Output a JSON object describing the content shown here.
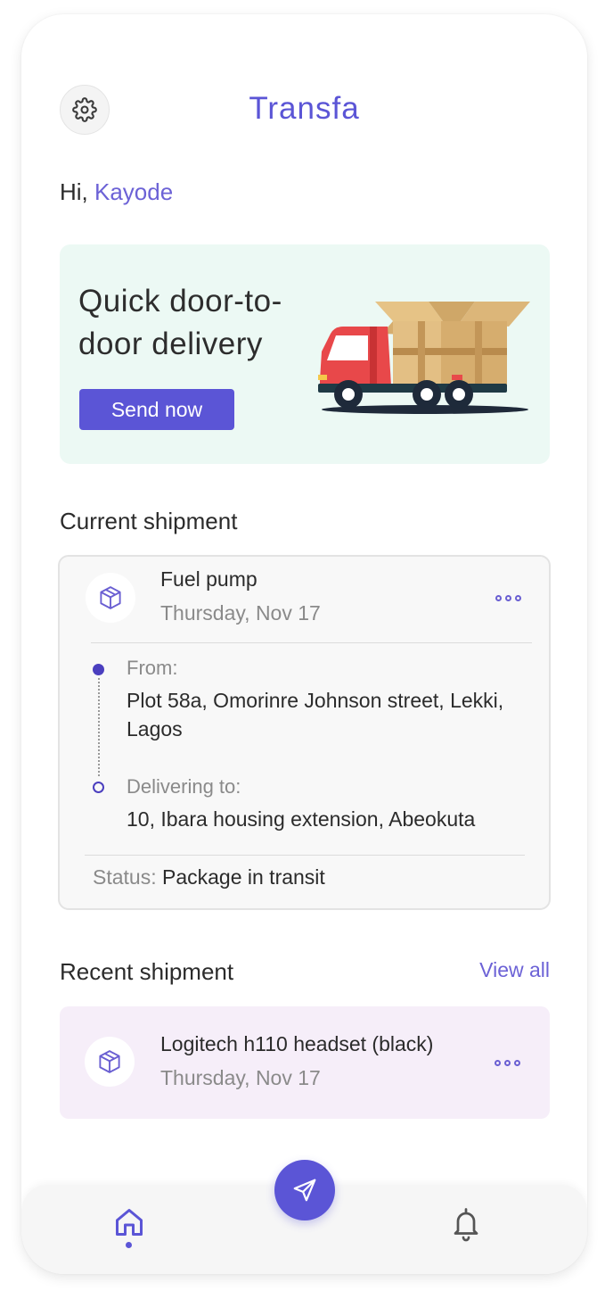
{
  "header": {
    "app_title": "Transfa"
  },
  "greeting": {
    "prefix": "Hi, ",
    "name": "Kayode"
  },
  "promo": {
    "title": "Quick door-to-door delivery",
    "button_label": "Send now"
  },
  "current_shipment": {
    "section_title": "Current shipment",
    "item_name": "Fuel pump",
    "date": "Thursday, Nov 17",
    "from_label": "From:",
    "from_address": "Plot 58a, Omorinre Johnson street, Lekki, Lagos",
    "to_label": "Delivering to:",
    "to_address": "10, Ibara housing extension, Abeokuta",
    "status_label": "Status: ",
    "status_value": "Package in transit"
  },
  "recent_shipment": {
    "section_title": "Recent shipment",
    "view_all_label": "View all",
    "item_name": "Logitech h110 headset (black)",
    "date": "Thursday, Nov 17"
  },
  "nav": {
    "items": [
      "home-icon",
      "send-icon",
      "bell-icon"
    ],
    "active": "home-icon"
  },
  "colors": {
    "brand": "#5b55d6",
    "promo_bg": "#ecf9f4",
    "recent_bg": "#f6eef9"
  }
}
